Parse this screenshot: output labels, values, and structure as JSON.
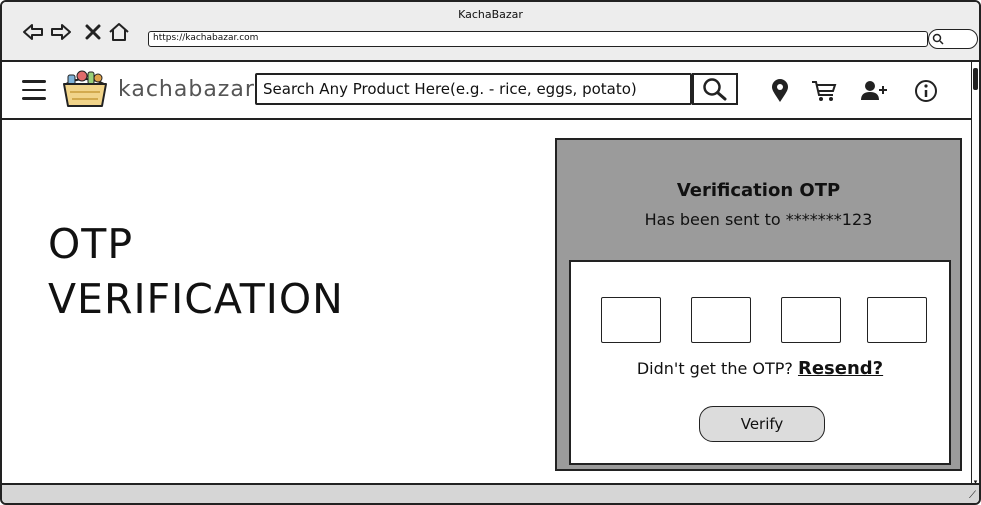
{
  "browser": {
    "window_title": "KachaBazar",
    "url": "https://kachabazar.com"
  },
  "header": {
    "brand": "kachabazar",
    "search_placeholder": "Search Any Product Here(e.g. - rice, eggs, potato)",
    "icons": [
      "menu-icon",
      "logo-basket",
      "search-icon",
      "location-pin-icon",
      "cart-icon",
      "add-user-icon",
      "info-icon"
    ]
  },
  "main": {
    "heading_line1": "OTP",
    "heading_line2": "VERIFICATION"
  },
  "otp_panel": {
    "title": "Verification OTP",
    "subtitle": "Has been sent to *******123",
    "box_count": 4,
    "resend_prompt": "Didn't get the OTP?",
    "resend_label": "Resend?",
    "verify_label": "Verify"
  },
  "colors": {
    "panel_bg": "#9b9b9b",
    "chrome_bg": "#ededed",
    "status_bg": "#d6d6d6"
  }
}
